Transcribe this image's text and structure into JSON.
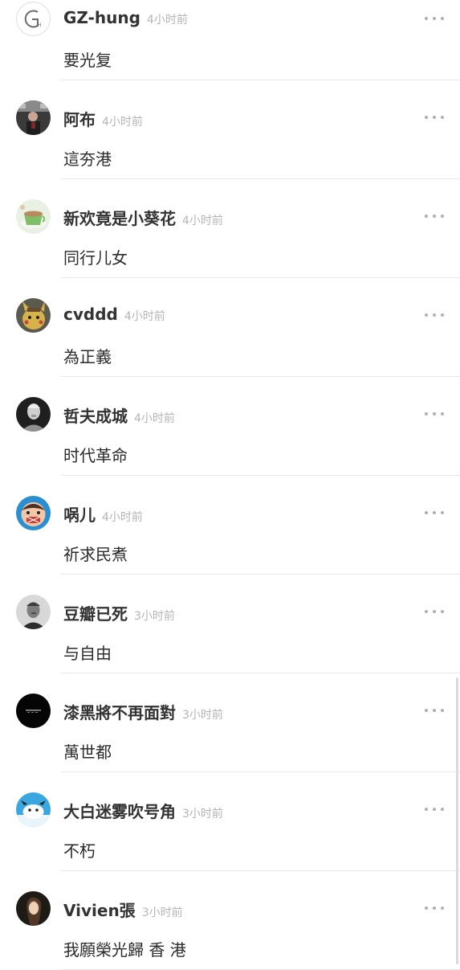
{
  "comments": [
    {
      "username": "GZ-hung",
      "time": "4小时前",
      "text": "要光复"
    },
    {
      "username": "阿布",
      "time": "4小时前",
      "text": "這夯港"
    },
    {
      "username": "新欢竟是小葵花",
      "time": "4小时前",
      "text": "同行儿女"
    },
    {
      "username": "cvddd",
      "time": "4小时前",
      "text": "為正義"
    },
    {
      "username": "哲夫成城",
      "time": "4小时前",
      "text": "时代革命"
    },
    {
      "username": "㖞儿",
      "time": "4小时前",
      "text": "祈求民煮"
    },
    {
      "username": "豆瓣已死",
      "time": "3小时前",
      "text": "与自由"
    },
    {
      "username": "漆黑將不再面對",
      "time": "3小时前",
      "text": "萬世都"
    },
    {
      "username": "大白迷雾吹号角",
      "time": "3小时前",
      "text": "不朽"
    },
    {
      "username": "Vivien張",
      "time": "3小时前",
      "text": "我願榮光歸 香 港"
    }
  ],
  "icons": {
    "more": "more-dots-icon"
  }
}
